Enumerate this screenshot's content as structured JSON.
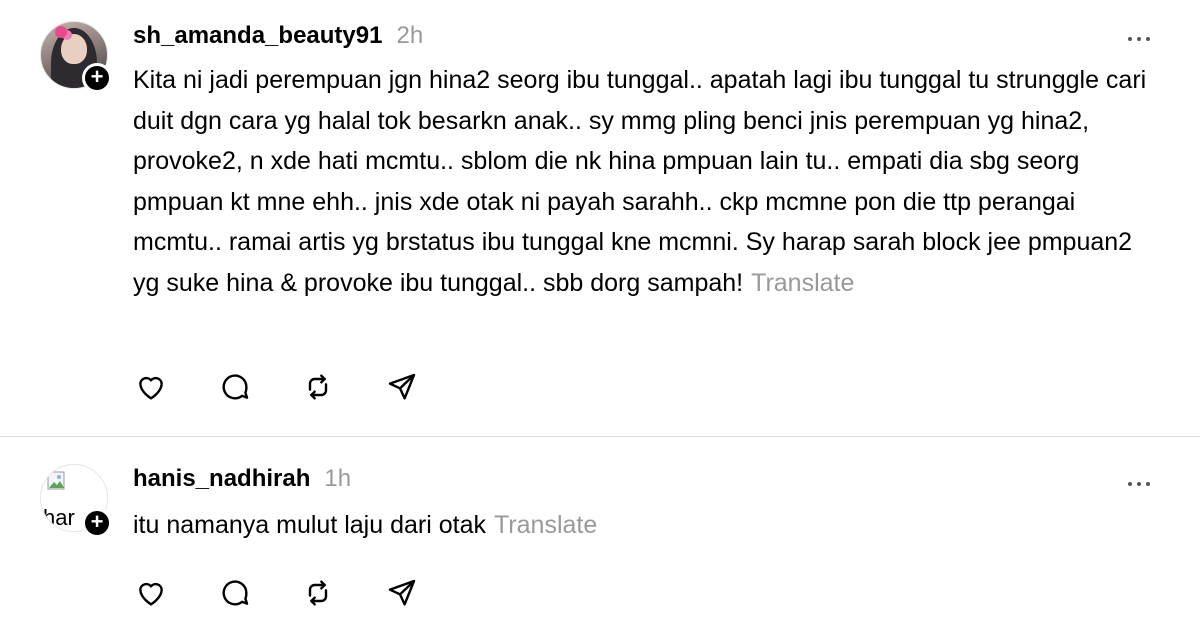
{
  "posts": [
    {
      "username": "sh_amanda_beauty91",
      "time": "2h",
      "text": "Kita ni jadi perempuan jgn hina2 seorg ibu tunggal.. apatah lagi ibu tunggal tu strunggle cari duit dgn cara yg halal tok besarkn anak.. sy mmg pling benci jnis perempuan yg hina2, provoke2, n xde hati mcmtu.. sblom die nk hina pmpuan lain tu.. empati dia sbg seorg pmpuan kt mne ehh.. jnis xde otak ni payah sarahh.. ckp mcmne pon die ttp perangai mcmtu.. ramai artis yg brstatus ibu tunggal kne mcmni. Sy harap sarah block jee pmpuan2 yg suke hina & provoke ibu tunggal.. sbb dorg sampah!",
      "translate": "Translate",
      "avatar": "profile-photo"
    },
    {
      "username": "hanis_nadhirah",
      "time": "1h",
      "text": "itu namanya mulut laju dari otak",
      "translate": "Translate",
      "avatar_alt": "har"
    }
  ],
  "follow_badge": "+",
  "icons": {
    "like": "heart-icon",
    "reply": "comment-icon",
    "repost": "repost-icon",
    "share": "send-icon",
    "more": "more-icon"
  },
  "colors": {
    "text": "#000000",
    "muted": "#999999",
    "divider": "#dcdcdc",
    "background": "#ffffff"
  }
}
